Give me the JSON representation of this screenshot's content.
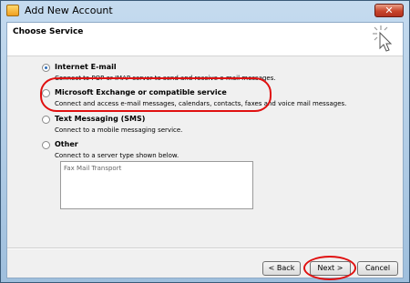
{
  "window": {
    "title": "Add New Account",
    "close_glyph": "✕"
  },
  "header": {
    "title": "Choose Service",
    "icon": "cursor-click-icon"
  },
  "options": [
    {
      "label": "Internet E-mail",
      "description": "Connect to POP or IMAP server to send and receive e-mail messages.",
      "selected": true
    },
    {
      "label": "Microsoft Exchange or compatible service",
      "description": "Connect and access e-mail messages, calendars, contacts, faxes and voice mail messages.",
      "selected": false
    },
    {
      "label": "Text Messaging (SMS)",
      "description": "Connect to a mobile messaging service.",
      "selected": false
    },
    {
      "label": "Other",
      "description": "Connect to a server type shown below.",
      "selected": false
    }
  ],
  "other_list": {
    "items": [
      "Fax Mail Transport"
    ]
  },
  "buttons": {
    "back": "< Back",
    "next": "Next >",
    "cancel": "Cancel"
  },
  "colors": {
    "highlight": "#e01010",
    "accent": "#2e6db8"
  }
}
